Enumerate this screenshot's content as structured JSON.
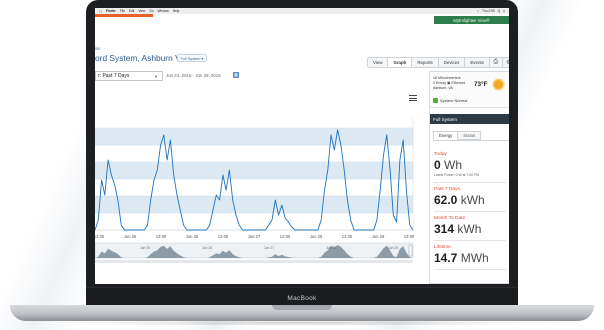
{
  "menubar": {
    "items": [
      "Finder",
      "File",
      "Edit",
      "View",
      "Go",
      "Window",
      "Help"
    ],
    "right": [
      " ",
      "Thu 2:59",
      "Q",
      "≡"
    ]
  },
  "header": {
    "brand_tab": "MyEnlighten View®",
    "site_crumb": "ise",
    "site_title": "ord System, Ashburn VA",
    "system_dropdown": "Full System ▾"
  },
  "tabs": [
    {
      "label": "View",
      "active": false
    },
    {
      "label": "Graph",
      "active": true
    },
    {
      "label": "Reports",
      "active": false
    },
    {
      "label": "Devices",
      "active": false
    },
    {
      "label": "Events",
      "active": false
    }
  ],
  "toolbar": {
    "range_value": "r: Past 7 Days",
    "date_range": "Jun 24, 2015 - Jun 29, 2015"
  },
  "chart_data": {
    "type": "area",
    "x_tick_labels": [
      "12:00",
      "Jun 25",
      "12:00",
      "Jun 26",
      "12:00",
      "Jun 27",
      "12:00",
      "Jun 28",
      "12:00",
      "Jun 29",
      "12:00"
    ],
    "mini_tick_labels": [
      "Jun 25",
      "Jun 26",
      "Jun 27",
      "Jun 28",
      "Jun 29"
    ],
    "series": [
      {
        "values": [
          0,
          0.1,
          0.5,
          0.35,
          0.7,
          0.55,
          0.45,
          0.3,
          0.05,
          0,
          0,
          0,
          0,
          0,
          0,
          0,
          0.05,
          0.3,
          0.5,
          0.6,
          0.85,
          0.95,
          0.7,
          0.9,
          0.55,
          0.35,
          0.2,
          0.05,
          0,
          0,
          0,
          0,
          0,
          0,
          0,
          0.05,
          0.2,
          0.35,
          0.3,
          0.55,
          0.4,
          0.6,
          0.3,
          0.15,
          0.05,
          0,
          0,
          0,
          0,
          0,
          0,
          0,
          0,
          0.05,
          0.1,
          0.3,
          0.15,
          0.25,
          0.12,
          0.08,
          0.03,
          0,
          0,
          0,
          0,
          0,
          0,
          0,
          0,
          0.1,
          0.4,
          0.6,
          0.95,
          0.8,
          1.0,
          0.85,
          0.6,
          0.3,
          0.1,
          0,
          0,
          0,
          0,
          0,
          0,
          0,
          0.1,
          0.4,
          0.75,
          0.95,
          0.6,
          0.15,
          0.08,
          0.7,
          0.9,
          0.4,
          0.05,
          0
        ]
      }
    ],
    "colors": {
      "line": "#1e73be",
      "band": "#dce9f3",
      "overview_fill": "#6b7d8c"
    },
    "grid": true
  },
  "side_panel": {
    "meter_lines": [
      "16 Microinverters",
      "1 Envoy ▣ Ethernet",
      "Ashburn, VA"
    ],
    "temperature": "73°F",
    "status": "System Normal",
    "section_title": "Full System",
    "side_tabs": [
      "Energy",
      "Status"
    ],
    "stats": [
      {
        "label": "Today",
        "value": "0",
        "unit": " Wh",
        "sub": "Latest Power: 0 W at 7:00 PM"
      },
      {
        "label": "Past 7 Days",
        "value": "62.0",
        "unit": " kWh",
        "sub": ""
      },
      {
        "label": "Month To Date",
        "value": "314",
        "unit": " kWh",
        "sub": ""
      },
      {
        "label": "Lifetime",
        "value": "14.7",
        "unit": " MWh",
        "sub": ""
      }
    ]
  },
  "laptop": {
    "brand": "MacBook"
  }
}
